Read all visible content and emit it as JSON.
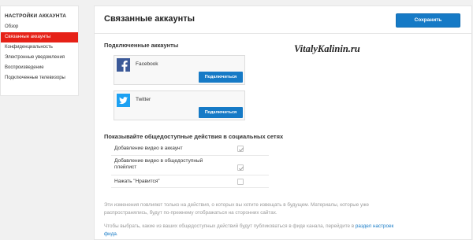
{
  "sidebar": {
    "title": "НАСТРОЙКИ АККАУНТА",
    "items": [
      {
        "label": "Обзор",
        "active": false
      },
      {
        "label": "Связанные аккаунты",
        "active": true
      },
      {
        "label": "Конфиденциальность",
        "active": false
      },
      {
        "label": "Электронные уведомления",
        "active": false
      },
      {
        "label": "Воспроизведение",
        "active": false
      },
      {
        "label": "Подключенные телевизоры",
        "active": false
      }
    ]
  },
  "header": {
    "title": "Связанные аккаунты",
    "save_label": "Сохранить"
  },
  "connected": {
    "heading": "Подключенные аккаунты",
    "accounts": [
      {
        "name": "Facebook",
        "icon": "facebook-icon",
        "button": "Подключиться"
      },
      {
        "name": "Twitter",
        "icon": "twitter-icon",
        "button": "Подключиться"
      }
    ]
  },
  "watermark": "VitalyKalinin.ru",
  "public_actions": {
    "heading": "Показывайте общедоступные действия в социальных сетях",
    "rows": [
      {
        "label": "Добавление видео в аккаунт",
        "checked": true
      },
      {
        "label": "Добавление видео в общедоступный плейлист",
        "checked": true
      },
      {
        "label": "Нажать \"Нравится\"",
        "checked": false
      }
    ]
  },
  "notes": {
    "changes": "Эти изменения повлияют только на действия, о которых вы хотите извещать в будущем. Материалы, которые уже распространялись, будут по-прежнему отображаться на сторонних сайтах.",
    "feed_text": "Чтобы выбрать, какие из ваших общедоступных действий будут публиковаться в фиде канала, перейдите в ",
    "feed_link": "раздел настроек фида",
    "feed_end": "."
  },
  "colors": {
    "accent": "#167ac6",
    "active_nav": "#e62117",
    "facebook": "#3b5998",
    "twitter": "#1da1f2"
  }
}
